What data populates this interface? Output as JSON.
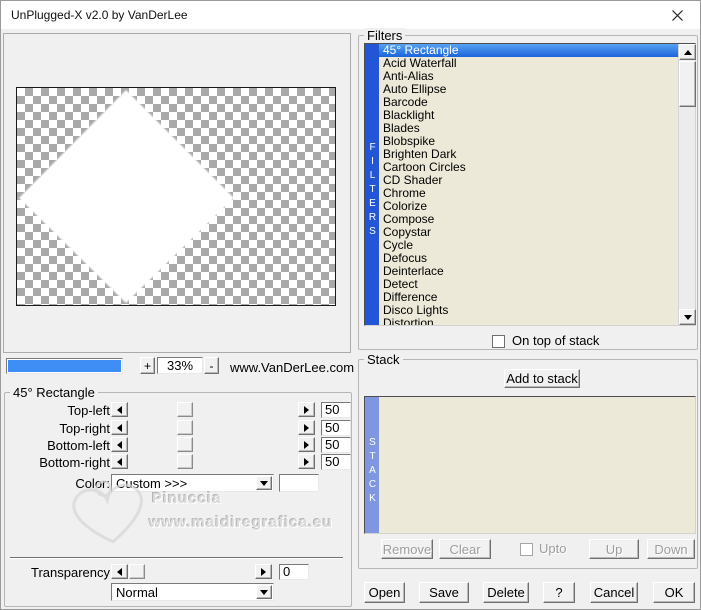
{
  "window": {
    "title": "UnPlugged-X v2.0 by VanDerLee"
  },
  "preview": {
    "zoom_in_label": "+",
    "zoom_out_label": "-",
    "zoom_percent": "33%",
    "site_label": "www.VanDerLee.com"
  },
  "filters": {
    "group_label": "Filters",
    "side_label": "FILTERS",
    "selected_index": 0,
    "items": [
      "45° Rectangle",
      "Acid Waterfall",
      "Anti-Alias",
      "Auto Ellipse",
      "Barcode",
      "Blacklight",
      "Blades",
      "Blobspike",
      "Brighten Dark",
      "Cartoon Circles",
      "CD Shader",
      "Chrome",
      "Colorize",
      "Compose",
      "Copystar",
      "Cycle",
      "Defocus",
      "Deinterlace",
      "Detect",
      "Difference",
      "Disco Lights",
      "Distortion"
    ],
    "on_top_label": "On top of stack"
  },
  "params": {
    "group_label": "45° Rectangle",
    "sliders": [
      {
        "label": "Top-left",
        "value": "50"
      },
      {
        "label": "Top-right",
        "value": "50"
      },
      {
        "label": "Bottom-left",
        "value": "50"
      },
      {
        "label": "Bottom-right",
        "value": "50"
      }
    ],
    "color_label": "Color:",
    "color_value": "Custom >>>",
    "transparency_label": "Transparency",
    "transparency_value": "0",
    "blend_mode": "Normal"
  },
  "watermark": {
    "name": "Pinuccia",
    "url": "www.maidiregrafica.eu"
  },
  "stack": {
    "group_label": "Stack",
    "side_label": "STACK",
    "add_button": "Add to stack",
    "remove_button": "Remove",
    "clear_button": "Clear",
    "upto_label": "Upto",
    "up_button": "Up",
    "down_button": "Down"
  },
  "footer": {
    "open": "Open",
    "save": "Save",
    "delete": "Delete",
    "help": "?",
    "cancel": "Cancel",
    "ok": "OK"
  },
  "colors": {
    "selection_blue": "#1b63da",
    "filters_bar_blue": "#2356d6",
    "stack_bar_blue": "#7f97e0",
    "progress_blue": "#3e8ef5",
    "list_beige": "#ece9d8"
  }
}
